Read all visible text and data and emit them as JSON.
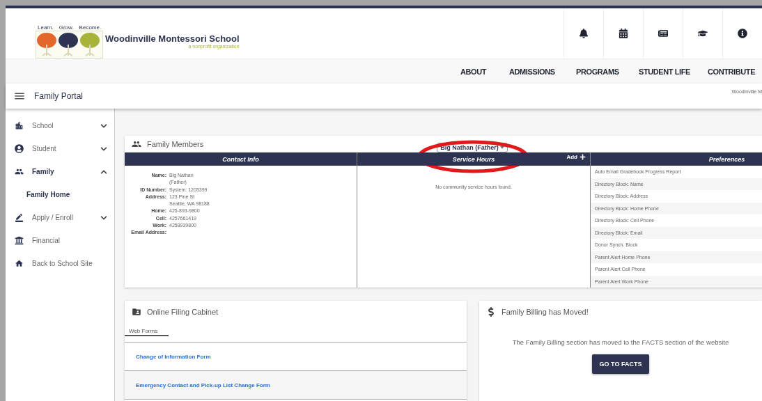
{
  "logo": {
    "tagline": [
      "Learn.",
      "Grow.",
      "Become."
    ],
    "name": "Woodinville Montessori School",
    "subtitle": "a nonprofit organization"
  },
  "nav": [
    "ABOUT",
    "ADMISSIONS",
    "PROGRAMS",
    "STUDENT LIFE",
    "CONTRIBUTE"
  ],
  "portal_bar": {
    "title": "Family Portal",
    "school": "Woodinville M"
  },
  "sidebar": {
    "items": [
      {
        "label": "School",
        "expanded": false,
        "has_children": true
      },
      {
        "label": "Student",
        "expanded": false,
        "has_children": true
      },
      {
        "label": "Family",
        "expanded": true,
        "has_children": true,
        "children": [
          {
            "label": "Family Home"
          }
        ]
      },
      {
        "label": "Apply / Enroll",
        "expanded": false,
        "has_children": true
      },
      {
        "label": "Financial",
        "has_children": false
      },
      {
        "label": "Back to School Site",
        "has_children": false
      }
    ]
  },
  "family_members": {
    "title": "Family Members",
    "member_select": "Big Nathan (Father)",
    "columns": [
      "Contact Info",
      "Service Hours",
      "Preferences"
    ],
    "add_label": "Add",
    "contact": [
      {
        "label": "Name:",
        "lines": [
          "Big Nathan",
          "(Father)"
        ]
      },
      {
        "label": "ID Number:",
        "lines": [
          "System: 1205399"
        ]
      },
      {
        "label": "Address:",
        "lines": [
          "123 Pine St",
          "Seattle, WA 98188"
        ]
      },
      {
        "label": "Home:",
        "lines": [
          "425-893-9800"
        ]
      },
      {
        "label": "Cell:",
        "lines": [
          "4257661419"
        ]
      },
      {
        "label": "Work:",
        "lines": [
          "4258939800"
        ]
      },
      {
        "label": "Email Address:"
      }
    ],
    "service_hours_empty": "No community service hours found.",
    "preferences": [
      "Auto Email Gradebook Progress Report",
      "Directory Block: Name",
      "Directory Block: Address",
      "Directory Block: Home Phone",
      "Directory Block: Cell Phone",
      "Directory Block: Email",
      "Donor Synch. Block",
      "Parent Alert Home Phone",
      "Parent Alert Cell Phone",
      "Parent Alert Work Phone"
    ]
  },
  "filing_cabinet": {
    "title": "Online Filing Cabinet",
    "tabs": [
      {
        "label": "Web Forms",
        "selected": true
      }
    ],
    "forms": [
      "Change of Information Form",
      "Emergency Contact and Pick-up List Change Form"
    ]
  },
  "billing": {
    "title": "Family Billing has Moved!",
    "message": "The Family Billing section has moved to the FACTS section of the website",
    "button": "GO TO FACTS"
  }
}
